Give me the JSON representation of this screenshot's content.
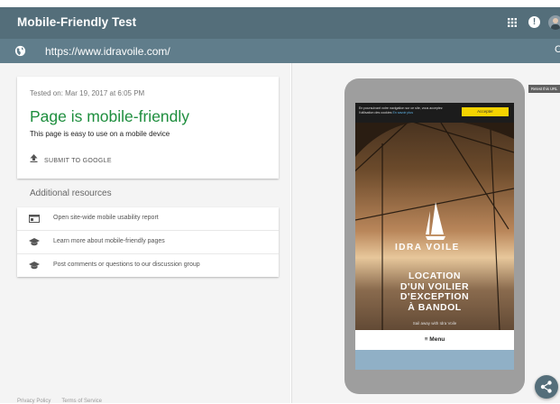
{
  "app": {
    "title": "Mobile-Friendly Test"
  },
  "header": {
    "icons": [
      "apps-grid-icon",
      "alert-icon",
      "avatar"
    ],
    "alert_label": "!"
  },
  "url_bar": {
    "url": "https://www.idravoile.com/",
    "left_icon": "globe-icon",
    "right_icon": "reload-icon",
    "right_glyph": "C"
  },
  "result": {
    "tested_on": "Tested on: Mar 19, 2017 at 6:05 PM",
    "status": "Page is mobile-friendly",
    "description": "This page is easy to use on a mobile device",
    "submit_label": "SUBMIT TO GOOGLE",
    "status_color": "#1e8e3e"
  },
  "resources": {
    "heading": "Additional resources",
    "items": [
      {
        "icon": "report-icon",
        "label": "Open site-wide mobile usability report"
      },
      {
        "icon": "school-icon",
        "label": "Learn more about mobile-friendly pages"
      },
      {
        "icon": "school-icon",
        "label": "Post comments or questions to our discussion group"
      }
    ]
  },
  "footer": {
    "privacy": "Privacy Policy",
    "terms": "Terms of Service"
  },
  "preview": {
    "retest_label": "Retest this URL",
    "cookie_text": "En poursuivant votre navigation sur ce site, vous acceptez l'utilisation des cookies",
    "cookie_link": "En savoir plus",
    "accept_label": "Accepter",
    "brand": "IDRA VOILE",
    "headline": [
      "LOCATION",
      "D'UN VOILIER",
      "D'EXCEPTION",
      "À BANDOL"
    ],
    "tagline": "Sail away with Idra Voile",
    "menu_label": "≡  Menu"
  },
  "colors": {
    "topbar": "#546e7a",
    "urlbar": "#607d8b",
    "accept": "#f5d300"
  }
}
